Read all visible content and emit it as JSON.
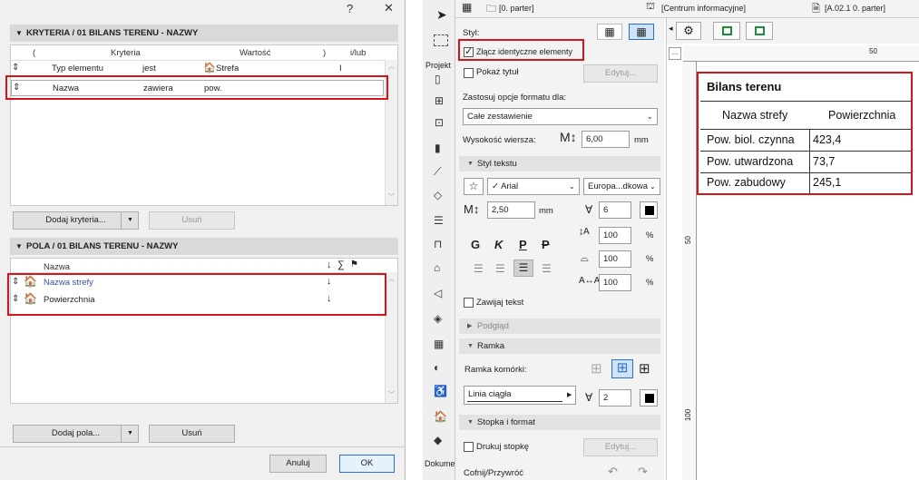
{
  "dialog": {
    "title_help": "?",
    "title_close": "✕",
    "criteria_header": "KRYTERIA / 01 BILANS TERENU - NAZWY",
    "criteria_columns": [
      "(",
      "Kryteria",
      "Wartość",
      ")",
      "i/lub"
    ],
    "criteria_rows": [
      {
        "field": "Typ elementu",
        "op": "jest",
        "value": "Strefa",
        "logic": "I"
      },
      {
        "field": "Nazwa",
        "op": "zawiera",
        "value": "pow.",
        "logic": ""
      }
    ],
    "add_criteria": "Dodaj kryteria...",
    "remove_criteria": "Usuń",
    "fields_header": "POLA / 01 BILANS TERENU - NAZWY",
    "fields_column": "Nazwa",
    "fields_rows": [
      {
        "name": "Nazwa strefy"
      },
      {
        "name": "Powierzchnia"
      }
    ],
    "add_fields": "Dodaj pola...",
    "remove_fields": "Usuń",
    "cancel": "Anuluj",
    "ok": "OK"
  },
  "topbar": {
    "story": "[0. parter]",
    "info": "[Centrum informacyjne]",
    "layout": "[A.02.1 0. parter]"
  },
  "tools": {
    "projekt": "Projekt",
    "dokumentacja": "Dokumen"
  },
  "panel": {
    "styl_label": "Styl:",
    "merge_label": "Złącz identyczne elementy",
    "show_title_label": "Pokaż tytuł",
    "edit_label": "Edytuj...",
    "apply_label": "Zastosuj opcje formatu dla:",
    "apply_value": "Całe zestawienie",
    "row_height_label": "Wysokość wiersza:",
    "row_height_value": "6,00",
    "row_height_unit": "mm",
    "text_style_section": "Styl tekstu",
    "font": "Arial",
    "encoding": "Europa...dkowa",
    "text_size": "2,50",
    "text_size_unit": "mm",
    "pen_value": "6",
    "scale_values": [
      "100",
      "100",
      "100"
    ],
    "percent": "%",
    "style_letters": [
      "G",
      "K",
      "P",
      "P"
    ],
    "wrap_label": "Zawijaj tekst",
    "preview_section": "Podgląd",
    "frame_section": "Ramka",
    "cell_frame_label": "Ramka komórki:",
    "line_type": "Linia ciągła",
    "line_pen": "2",
    "footer_section": "Stopka i format",
    "print_footer_label": "Drukuj stopkę",
    "footer_edit": "Edytuj...",
    "undo_label": "Cofnij/Przywróć"
  },
  "schedule": {
    "title": "Bilans terenu",
    "col1": "Nazwa strefy",
    "col2": "Powierzchnia",
    "rows": [
      {
        "name": "Pow. biol. czynna",
        "area": "423,4"
      },
      {
        "name": "Pow. utwardzona",
        "area": "73,7"
      },
      {
        "name": "Pow. zabudowy",
        "area": "245,1"
      }
    ],
    "ruler_top": "50",
    "ruler_left": [
      "50",
      "100"
    ],
    "ellipsis": "..."
  },
  "colors": {
    "highlight": "#d7141a",
    "link_blue": "#3a4fb0",
    "accent": "#2a6fd6"
  }
}
